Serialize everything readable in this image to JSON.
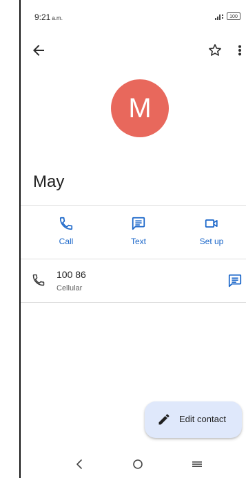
{
  "status_bar": {
    "time": "9:21",
    "ampm": "a.m.",
    "battery": "100"
  },
  "contact": {
    "avatar_letter": "M",
    "name": "May"
  },
  "actions": {
    "call_label": "Call",
    "text_label": "Text",
    "setup_label": "Set up"
  },
  "phone": {
    "number": "100 86",
    "type": "Cellular"
  },
  "fab": {
    "label": "Edit contact"
  },
  "icons": {
    "back": "arrow-back-icon",
    "star": "star-outline-icon",
    "more": "more-vert-icon",
    "call": "phone-icon",
    "text": "message-icon",
    "setup": "videocam-icon",
    "edit": "pencil-icon",
    "nav_back": "nav-back-icon",
    "nav_home": "nav-home-icon",
    "nav_recents": "nav-menu-icon"
  },
  "colors": {
    "accent": "#1a66c9",
    "avatar": "#e8685c",
    "fab_background": "#dfe8fb"
  }
}
